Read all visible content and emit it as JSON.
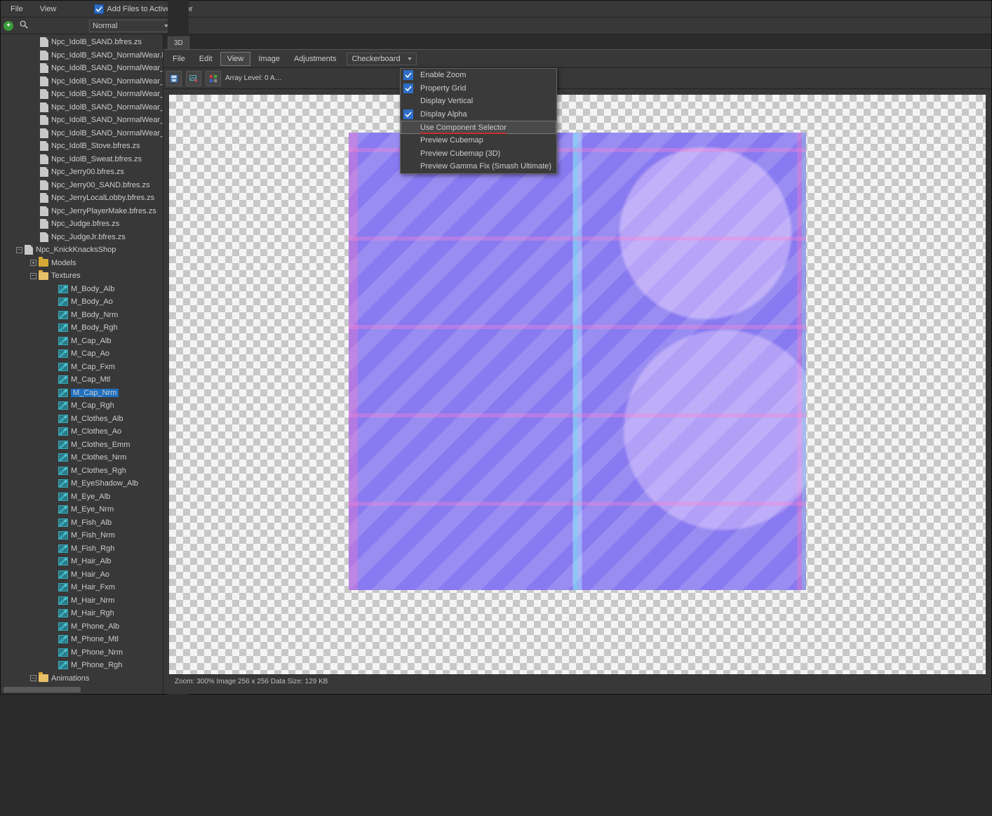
{
  "topmenu": {
    "file": "File",
    "view": "View"
  },
  "add_files_label": "Add Files to Active Editor",
  "mode_dd": "Normal",
  "tree_files": [
    "Npc_IdolB_SAND.bfres.zs",
    "Npc_IdolB_SAND_NormalWear.bfres.zs",
    "Npc_IdolB_SAND_NormalWear_Fes_Sand…",
    "Npc_IdolB_SAND_NormalWear_Fes_Sand…",
    "Npc_IdolB_SAND_NormalWear_Fes_Sand…",
    "Npc_IdolB_SAND_NormalWear_Fes_Sand…",
    "Npc_IdolB_SAND_NormalWear_Fes_Sand…",
    "Npc_IdolB_SAND_NormalWear_Fes_Sand…",
    "Npc_IdolB_Stove.bfres.zs",
    "Npc_IdolB_Sweat.bfres.zs",
    "Npc_Jerry00.bfres.zs",
    "Npc_Jerry00_SAND.bfres.zs",
    "Npc_JerryLocalLobby.bfres.zs",
    "Npc_JerryPlayerMake.bfres.zs",
    "Npc_Judge.bfres.zs",
    "Npc_JudgeJr.bfres.zs"
  ],
  "tree_open_file": "Npc_KnickKnacksShop",
  "folders": {
    "models": "Models",
    "textures": "Textures",
    "animations": "Animations"
  },
  "textures": [
    "M_Body_Alb",
    "M_Body_Ao",
    "M_Body_Nrm",
    "M_Body_Rgh",
    "M_Cap_Alb",
    "M_Cap_Ao",
    "M_Cap_Fxm",
    "M_Cap_Mtl",
    "M_Cap_Nrm",
    "M_Cap_Rgh",
    "M_Clothes_Alb",
    "M_Clothes_Ao",
    "M_Clothes_Emm",
    "M_Clothes_Nrm",
    "M_Clothes_Rgh",
    "M_EyeShadow_Alb",
    "M_Eye_Alb",
    "M_Eye_Nrm",
    "M_Fish_Alb",
    "M_Fish_Nrm",
    "M_Fish_Rgh",
    "M_Hair_Alb",
    "M_Hair_Ao",
    "M_Hair_Fxm",
    "M_Hair_Nrm",
    "M_Hair_Rgh",
    "M_Phone_Alb",
    "M_Phone_Mtl",
    "M_Phone_Nrm",
    "M_Phone_Rgh"
  ],
  "selected_texture": "M_Cap_Nrm",
  "editor": {
    "tab": "3D",
    "menu": {
      "file": "File",
      "edit": "Edit",
      "view": "View",
      "image": "Image",
      "adjustments": "Adjustments"
    },
    "bg_dd": "Checkerboard",
    "array_level": "Array Level: 0  A…"
  },
  "view_menu": [
    {
      "label": "Enable Zoom",
      "checked": true
    },
    {
      "label": "Property Grid",
      "checked": true
    },
    {
      "label": "Display Vertical",
      "checked": false
    },
    {
      "label": "Display Alpha",
      "checked": true
    },
    {
      "label": "Use Component Selector",
      "checked": false,
      "highlight": true
    },
    {
      "label": "Preview Cubemap",
      "checked": false
    },
    {
      "label": "Preview Cubemap (3D)",
      "checked": false
    },
    {
      "label": "Preview Gamma Fix (Smash Ultimate)",
      "checked": false
    }
  ],
  "status": "Zoom: 300% Image 256 x 256 Data Size: 129 KB"
}
